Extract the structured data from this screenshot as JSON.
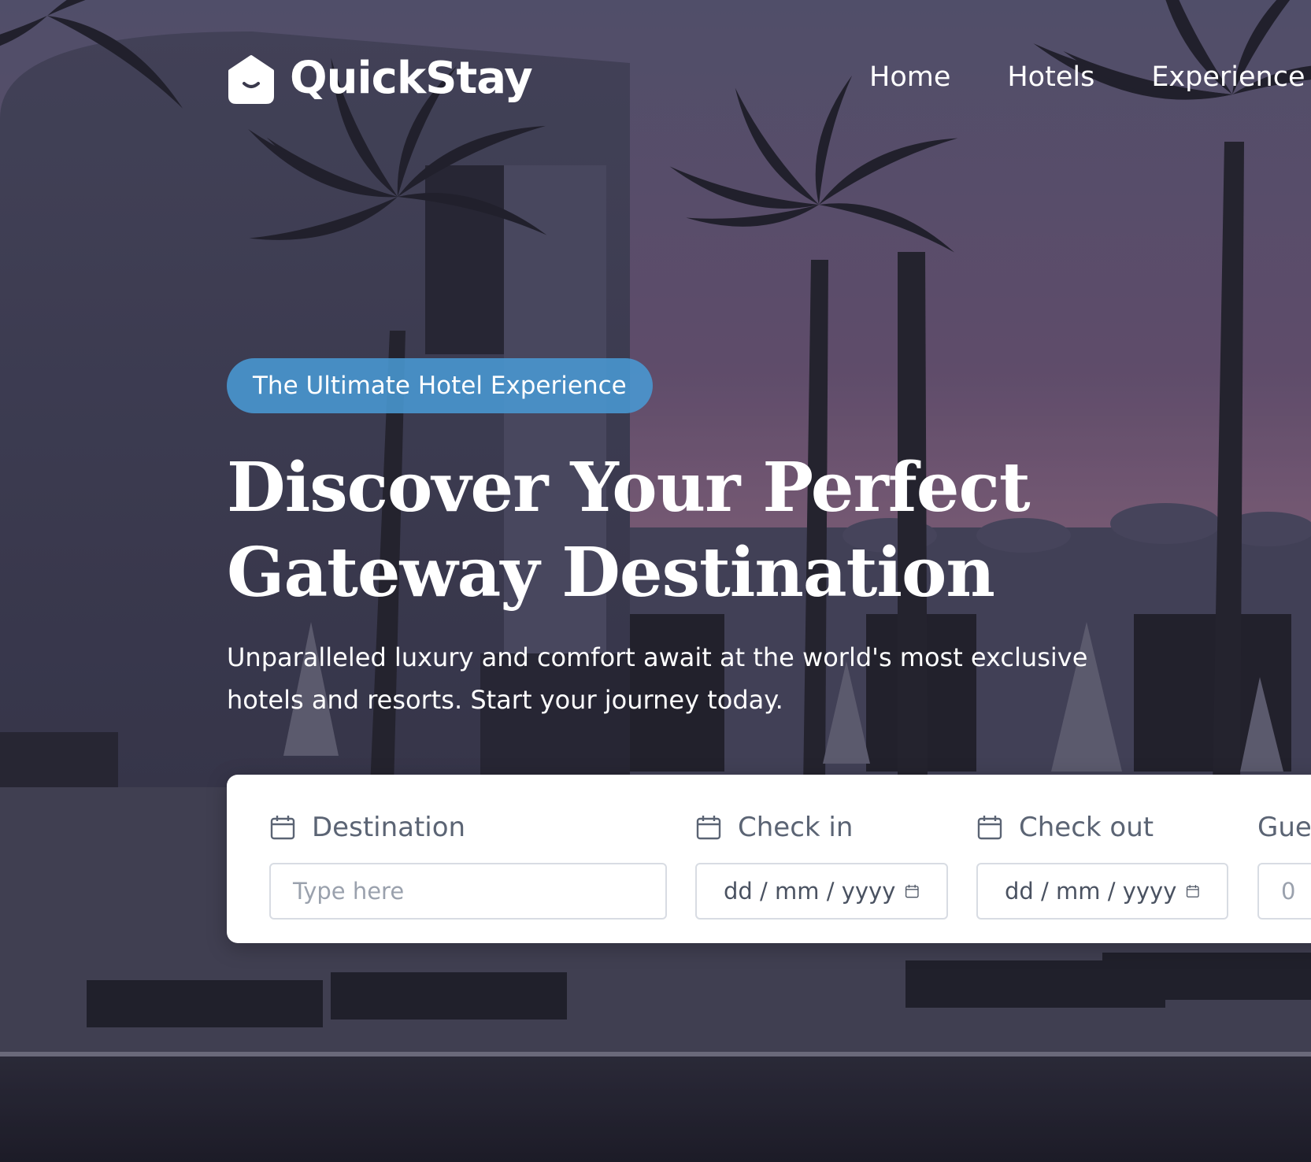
{
  "brand": {
    "name": "QuickStay",
    "logo_icon": "house-smile-icon"
  },
  "nav": {
    "items": [
      {
        "label": "Home"
      },
      {
        "label": "Hotels"
      },
      {
        "label": "Experience"
      }
    ]
  },
  "hero": {
    "badge": "The Ultimate Hotel Experience",
    "headline_line1": "Discover Your Perfect",
    "headline_line2": "Gateway Destination",
    "subtext": "Unparalleled luxury and comfort await at the world's most exclusive hotels and resorts. Start your journey today.",
    "background_description_icon": "resort-pool-palm-trees-at-dusk"
  },
  "search": {
    "destination": {
      "label": "Destination",
      "placeholder": "Type here",
      "icon": "calendar-icon"
    },
    "check_in": {
      "label": "Check in",
      "value": "dd / mm / yyyy",
      "icon": "calendar-icon"
    },
    "check_out": {
      "label": "Check out",
      "value": "dd / mm / yyyy",
      "icon": "calendar-icon"
    },
    "guests": {
      "label": "Guests",
      "value": "0"
    }
  },
  "colors": {
    "badge": "#4999D3",
    "card": "#FFFFFF",
    "label": "#5B6474",
    "sky_top": "#5E5A78",
    "sky_glow": "#E4A07A"
  }
}
